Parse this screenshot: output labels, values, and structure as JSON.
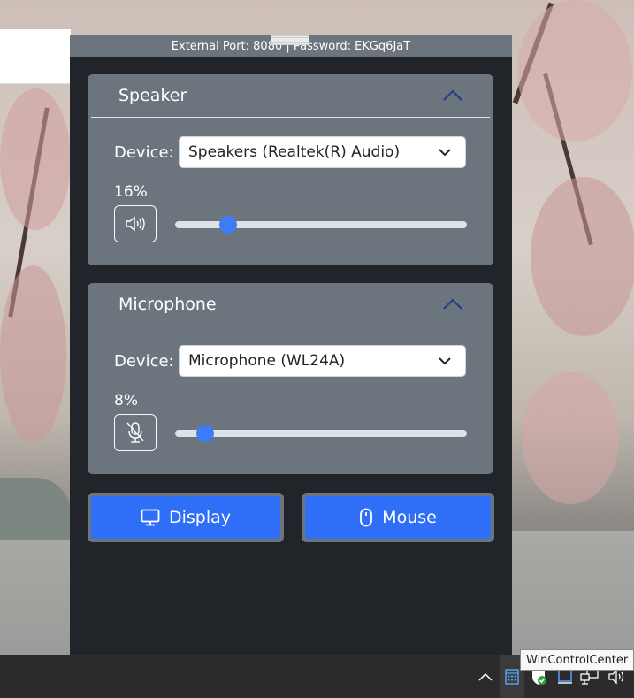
{
  "window": {
    "status_text": "External Port: 8080 | Password: EKGq6JaT"
  },
  "speaker": {
    "title": "Speaker",
    "device_label": "Device:",
    "device_value": "Speakers (Realtek(R) Audio)",
    "volume_text": "16%",
    "volume": 0.16,
    "icon": "speaker-volume-icon"
  },
  "microphone": {
    "title": "Microphone",
    "device_label": "Device:",
    "device_value": "Microphone (WL24A)",
    "volume_text": "8%",
    "volume": 0.08,
    "icon": "microphone-muted-icon"
  },
  "buttons": {
    "display_label": "Display",
    "mouse_label": "Mouse"
  },
  "taskbar": {
    "tooltip": "WinControlCenter",
    "tray_icons": [
      "chevron-up-icon",
      "calculator-icon",
      "defender-icon",
      "tablet-icon",
      "network-icon",
      "volume-icon"
    ]
  },
  "colors": {
    "accent": "#2f6ff7",
    "card": "#6c757d",
    "panel": "#212529"
  }
}
